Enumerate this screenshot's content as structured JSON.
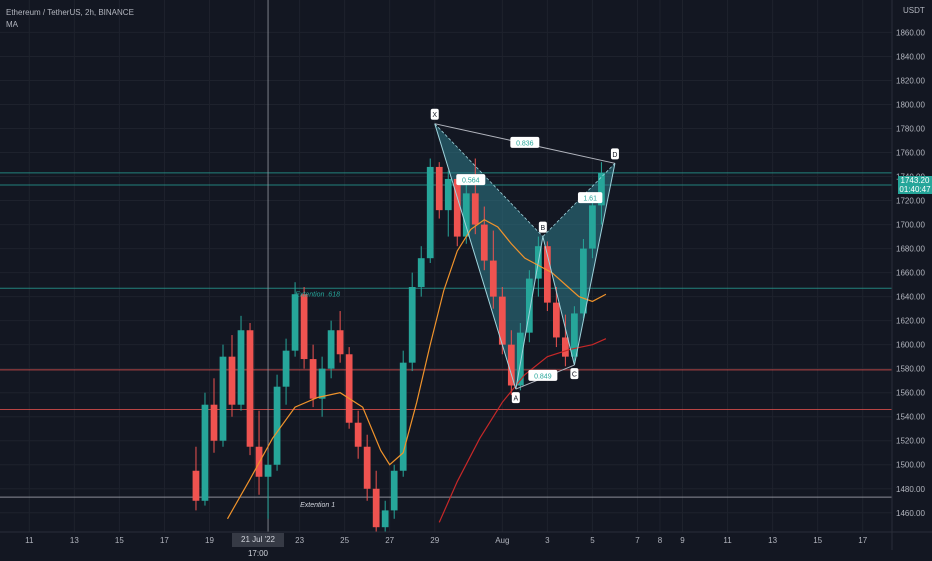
{
  "header": {
    "title": "Ethereum / TetherUS, 2h, BINANCE",
    "indicator": "MA",
    "currency": "USDT"
  },
  "price_tag": {
    "price": "1743.20",
    "countdown": "01:40:47",
    "color": "#26a69a"
  },
  "crosshair_date": "21 Jul '22  17:00",
  "colors": {
    "background": "#131722",
    "up": "#26a69a",
    "down": "#ef5350",
    "ma_fast": "#f0932b",
    "ma_slow": "#c62828",
    "pattern_fill": "#2f7c8a",
    "pattern_line": "#9fd3dc",
    "grid": "#1e222d"
  },
  "chart_data": {
    "type": "candlestick",
    "y_axis": {
      "ticks": [
        1460,
        1480,
        1500,
        1520,
        1540,
        1560,
        1580,
        1600,
        1620,
        1640,
        1660,
        1680,
        1700,
        1720,
        1740,
        1760,
        1780,
        1800,
        1820,
        1840,
        1860
      ],
      "tick_labels": [
        "1460.00",
        "1480.00",
        "1500.00",
        "1520.00",
        "1540.00",
        "1560.00",
        "1580.00",
        "1600.00",
        "1620.00",
        "1640.00",
        "1660.00",
        "1680.00",
        "1700.00",
        "1720.00",
        "1740.00",
        "1760.00",
        "1780.00",
        "1800.00",
        "1820.00",
        "1840.00",
        "1860.00"
      ],
      "range": [
        1444,
        1887
      ]
    },
    "x_axis": {
      "tick_labels": [
        "11",
        "13",
        "15",
        "17",
        "19",
        "21",
        "23",
        "25",
        "27",
        "29",
        "Aug",
        "3",
        "5",
        "7",
        "8",
        "9",
        "11",
        "13",
        "15",
        "17"
      ],
      "x_values": [
        -10,
        -8,
        -6,
        -4,
        -2,
        0,
        2,
        4,
        6,
        8,
        11,
        13,
        15,
        17,
        18,
        19,
        21,
        23,
        25,
        27
      ],
      "range": [
        -11.3,
        28.3
      ]
    },
    "horizontal_levels": [
      {
        "price": 1647,
        "color": "#26a69a"
      },
      {
        "price": 1579,
        "color": "#ef5350"
      },
      {
        "price": 1546,
        "color": "#ef5350"
      },
      {
        "price": 1743,
        "color": "#26a69a"
      },
      {
        "price": 1733,
        "color": "#26a69a"
      },
      {
        "price": 1473,
        "color": "#b2b5be"
      }
    ],
    "candles": [
      {
        "t": -2.6,
        "o": 1495,
        "h": 1515,
        "l": 1462,
        "c": 1470
      },
      {
        "t": -2.2,
        "o": 1470,
        "h": 1560,
        "l": 1466,
        "c": 1550
      },
      {
        "t": -1.8,
        "o": 1550,
        "h": 1572,
        "l": 1510,
        "c": 1520
      },
      {
        "t": -1.4,
        "o": 1520,
        "h": 1600,
        "l": 1515,
        "c": 1590
      },
      {
        "t": -1.0,
        "o": 1590,
        "h": 1608,
        "l": 1540,
        "c": 1550
      },
      {
        "t": -0.6,
        "o": 1550,
        "h": 1624,
        "l": 1545,
        "c": 1612
      },
      {
        "t": -0.2,
        "o": 1612,
        "h": 1618,
        "l": 1508,
        "c": 1515
      },
      {
        "t": 0.2,
        "o": 1515,
        "h": 1545,
        "l": 1475,
        "c": 1490
      },
      {
        "t": 0.6,
        "o": 1490,
        "h": 1510,
        "l": 1455,
        "c": 1500
      },
      {
        "t": 1.0,
        "o": 1500,
        "h": 1575,
        "l": 1495,
        "c": 1565
      },
      {
        "t": 1.4,
        "o": 1565,
        "h": 1605,
        "l": 1550,
        "c": 1595
      },
      {
        "t": 1.8,
        "o": 1595,
        "h": 1652,
        "l": 1590,
        "c": 1642
      },
      {
        "t": 2.2,
        "o": 1642,
        "h": 1648,
        "l": 1580,
        "c": 1588
      },
      {
        "t": 2.6,
        "o": 1588,
        "h": 1600,
        "l": 1548,
        "c": 1555
      },
      {
        "t": 3.0,
        "o": 1555,
        "h": 1590,
        "l": 1540,
        "c": 1580
      },
      {
        "t": 3.4,
        "o": 1580,
        "h": 1620,
        "l": 1572,
        "c": 1612
      },
      {
        "t": 3.8,
        "o": 1612,
        "h": 1628,
        "l": 1585,
        "c": 1592
      },
      {
        "t": 4.2,
        "o": 1592,
        "h": 1598,
        "l": 1530,
        "c": 1535
      },
      {
        "t": 4.6,
        "o": 1535,
        "h": 1545,
        "l": 1505,
        "c": 1515
      },
      {
        "t": 5.0,
        "o": 1515,
        "h": 1525,
        "l": 1470,
        "c": 1480
      },
      {
        "t": 5.4,
        "o": 1480,
        "h": 1495,
        "l": 1440,
        "c": 1448
      },
      {
        "t": 5.8,
        "o": 1448,
        "h": 1470,
        "l": 1440,
        "c": 1462
      },
      {
        "t": 6.2,
        "o": 1462,
        "h": 1500,
        "l": 1455,
        "c": 1495
      },
      {
        "t": 6.6,
        "o": 1495,
        "h": 1595,
        "l": 1490,
        "c": 1585
      },
      {
        "t": 7.0,
        "o": 1585,
        "h": 1660,
        "l": 1578,
        "c": 1648
      },
      {
        "t": 7.4,
        "o": 1648,
        "h": 1682,
        "l": 1640,
        "c": 1672
      },
      {
        "t": 7.8,
        "o": 1672,
        "h": 1755,
        "l": 1668,
        "c": 1748
      },
      {
        "t": 8.2,
        "o": 1748,
        "h": 1752,
        "l": 1705,
        "c": 1712
      },
      {
        "t": 8.6,
        "o": 1712,
        "h": 1745,
        "l": 1690,
        "c": 1738
      },
      {
        "t": 9.0,
        "o": 1738,
        "h": 1742,
        "l": 1682,
        "c": 1690
      },
      {
        "t": 9.4,
        "o": 1690,
        "h": 1735,
        "l": 1684,
        "c": 1726
      },
      {
        "t": 9.8,
        "o": 1726,
        "h": 1755,
        "l": 1692,
        "c": 1700
      },
      {
        "t": 10.2,
        "o": 1700,
        "h": 1715,
        "l": 1662,
        "c": 1670
      },
      {
        "t": 10.6,
        "o": 1670,
        "h": 1695,
        "l": 1630,
        "c": 1640
      },
      {
        "t": 11.0,
        "o": 1640,
        "h": 1648,
        "l": 1592,
        "c": 1600
      },
      {
        "t": 11.4,
        "o": 1600,
        "h": 1612,
        "l": 1558,
        "c": 1566
      },
      {
        "t": 11.8,
        "o": 1566,
        "h": 1618,
        "l": 1562,
        "c": 1610
      },
      {
        "t": 12.2,
        "o": 1610,
        "h": 1662,
        "l": 1602,
        "c": 1655
      },
      {
        "t": 12.6,
        "o": 1655,
        "h": 1690,
        "l": 1640,
        "c": 1682
      },
      {
        "t": 13.0,
        "o": 1682,
        "h": 1686,
        "l": 1628,
        "c": 1635
      },
      {
        "t": 13.4,
        "o": 1635,
        "h": 1648,
        "l": 1598,
        "c": 1606
      },
      {
        "t": 13.8,
        "o": 1606,
        "h": 1625,
        "l": 1582,
        "c": 1590
      },
      {
        "t": 14.2,
        "o": 1590,
        "h": 1632,
        "l": 1586,
        "c": 1626
      },
      {
        "t": 14.6,
        "o": 1626,
        "h": 1688,
        "l": 1622,
        "c": 1680
      },
      {
        "t": 15.0,
        "o": 1680,
        "h": 1722,
        "l": 1672,
        "c": 1716
      },
      {
        "t": 15.4,
        "o": 1716,
        "h": 1752,
        "l": 1700,
        "c": 1743
      }
    ],
    "moving_averages": [
      {
        "color": "#f0932b",
        "points": [
          [
            -1.2,
            1455
          ],
          [
            -0.2,
            1488
          ],
          [
            0.8,
            1522
          ],
          [
            1.8,
            1548
          ],
          [
            2.8,
            1556
          ],
          [
            3.8,
            1560
          ],
          [
            4.8,
            1548
          ],
          [
            5.6,
            1512
          ],
          [
            6.0,
            1500
          ],
          [
            6.6,
            1510
          ],
          [
            7.2,
            1552
          ],
          [
            7.8,
            1600
          ],
          [
            8.4,
            1645
          ],
          [
            9.0,
            1678
          ],
          [
            9.6,
            1696
          ],
          [
            10.2,
            1704
          ],
          [
            10.8,
            1698
          ],
          [
            11.4,
            1684
          ],
          [
            12.0,
            1672
          ],
          [
            12.6,
            1666
          ],
          [
            13.2,
            1660
          ],
          [
            13.8,
            1650
          ],
          [
            14.4,
            1640
          ],
          [
            15.0,
            1636
          ],
          [
            15.6,
            1642
          ]
        ]
      },
      {
        "color": "#c62828",
        "points": [
          [
            8.2,
            1452
          ],
          [
            9.0,
            1486
          ],
          [
            10.0,
            1522
          ],
          [
            11.0,
            1552
          ],
          [
            12.0,
            1575
          ],
          [
            13.0,
            1590
          ],
          [
            14.0,
            1596
          ],
          [
            15.0,
            1600
          ],
          [
            15.6,
            1605
          ]
        ]
      }
    ],
    "harmonic_pattern": {
      "points": [
        {
          "label": "X",
          "t": 8.0,
          "p": 1784
        },
        {
          "label": "A",
          "t": 11.6,
          "p": 1563
        },
        {
          "label": "B",
          "t": 12.8,
          "p": 1690
        },
        {
          "label": "C",
          "t": 14.2,
          "p": 1583
        },
        {
          "label": "D",
          "t": 16.0,
          "p": 1751
        }
      ],
      "ratios": [
        {
          "text": "0.836",
          "t": 12.0,
          "p": 1768
        },
        {
          "text": "0.564",
          "t": 9.6,
          "p": 1737
        },
        {
          "text": "0.849",
          "t": 12.8,
          "p": 1574
        },
        {
          "text": "1.61",
          "t": 14.9,
          "p": 1722
        }
      ]
    },
    "annotations": [
      {
        "text": "Extention .618",
        "t": 2.8,
        "p": 1640,
        "color": "#26a69a"
      },
      {
        "text": "Extention 1",
        "t": 2.8,
        "p": 1465,
        "color": "#d1d4dc"
      }
    ],
    "crosshair_x": 0.6
  }
}
